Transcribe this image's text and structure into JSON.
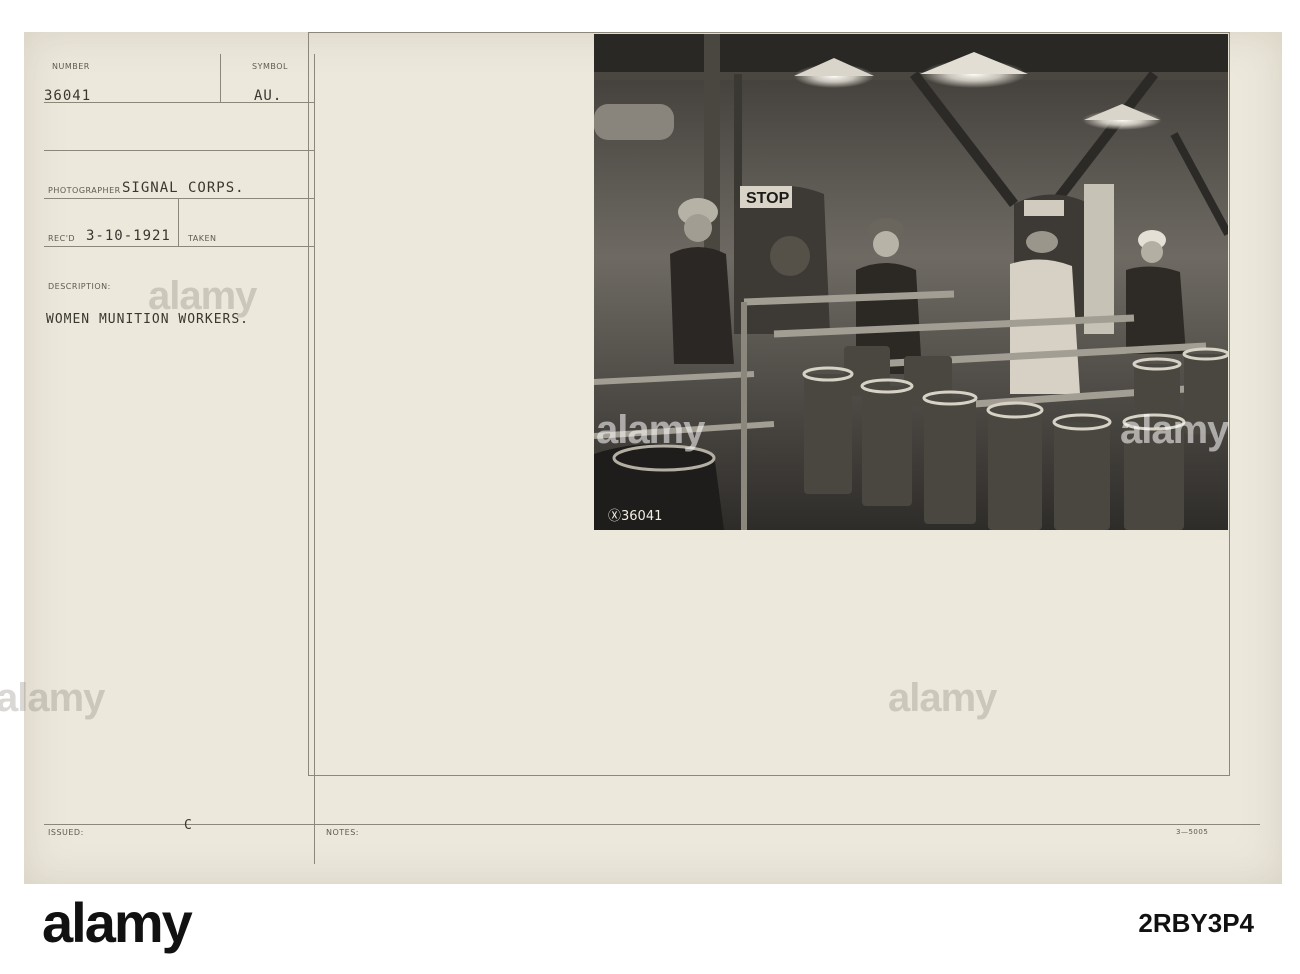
{
  "card": {
    "number_label": "NUMBER",
    "number_value": "36041",
    "symbol_label": "SYMBOL",
    "symbol_value": "AU.",
    "photographer_label": "PHOTOGRAPHER",
    "photographer_value": "SIGNAL CORPS.",
    "recd_label": "REC'D",
    "recd_value": "3-10-1921",
    "taken_label": "TAKEN",
    "description_label": "DESCRIPTION:",
    "description_value": "WOMEN MUNITION WORKERS.",
    "issued_label": "ISSUED:",
    "issued_value": "C",
    "notes_label": "NOTES:",
    "form_code": "3—5005"
  },
  "photo": {
    "sign_text": "STOP",
    "negative_number": "Ⓧ36041"
  },
  "watermark": {
    "text": "alamy"
  },
  "footer": {
    "logo": "alamy",
    "image_id": "2RBY3P4"
  }
}
